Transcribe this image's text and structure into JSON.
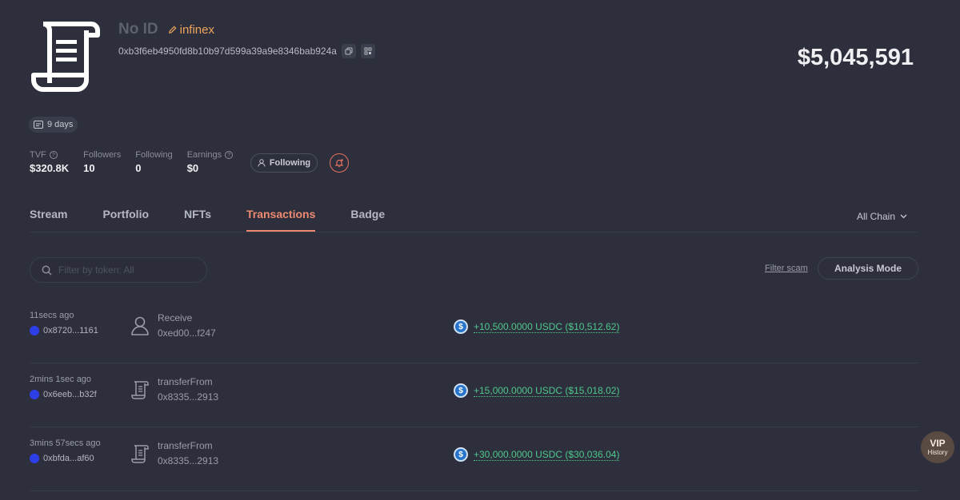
{
  "profile": {
    "name": "No ID",
    "ens": "infinex",
    "address": "0xb3f6eb4950fd8b10b97d599a39a9e8346bab924a",
    "balance": "$5,045,591",
    "age": "9 days",
    "avatar_icon": "scroll-contract-icon"
  },
  "stats": [
    {
      "label": "TVF",
      "value": "$320.8K",
      "help": true
    },
    {
      "label": "Followers",
      "value": "10",
      "help": false
    },
    {
      "label": "Following",
      "value": "0",
      "help": false
    },
    {
      "label": "Earnings",
      "value": "$0",
      "help": true
    }
  ],
  "actions": {
    "follow_label": "Following"
  },
  "tabs": [
    {
      "label": "Stream",
      "active": false
    },
    {
      "label": "Portfolio",
      "active": false
    },
    {
      "label": "NFTs",
      "active": false
    },
    {
      "label": "Transactions",
      "active": true
    },
    {
      "label": "Badge",
      "active": false
    }
  ],
  "chain_selector": "All Chain",
  "filters": {
    "search_placeholder": "Filter by token: All",
    "filter_scam": "Filter scam",
    "analysis_mode": "Analysis Mode"
  },
  "transactions": [
    {
      "time": "11secs ago",
      "chain_address": "0x8720...1161",
      "icon": "user-icon",
      "action": "Receive",
      "counterparty": "0xed00...f247",
      "amount": "+10,500.0000 USDC ($10,512.62)"
    },
    {
      "time": "2mins 1sec ago",
      "chain_address": "0x6eeb...b32f",
      "icon": "contract-icon",
      "action": "transferFrom",
      "counterparty": "0x8335...2913",
      "amount": "+15,000.0000 USDC ($15,018.02)"
    },
    {
      "time": "3mins 57secs ago",
      "chain_address": "0xbfda...af60",
      "icon": "contract-icon",
      "action": "transferFrom",
      "counterparty": "0x8335...2913",
      "amount": "+30,000.0000 USDC ($30,036.04)"
    }
  ],
  "vip": {
    "title": "VIP",
    "subtitle": "History"
  },
  "colors": {
    "background": "#2d2f3d",
    "accent": "#ef8a70",
    "positive": "#4ec78b",
    "ens": "#f0a55a"
  }
}
